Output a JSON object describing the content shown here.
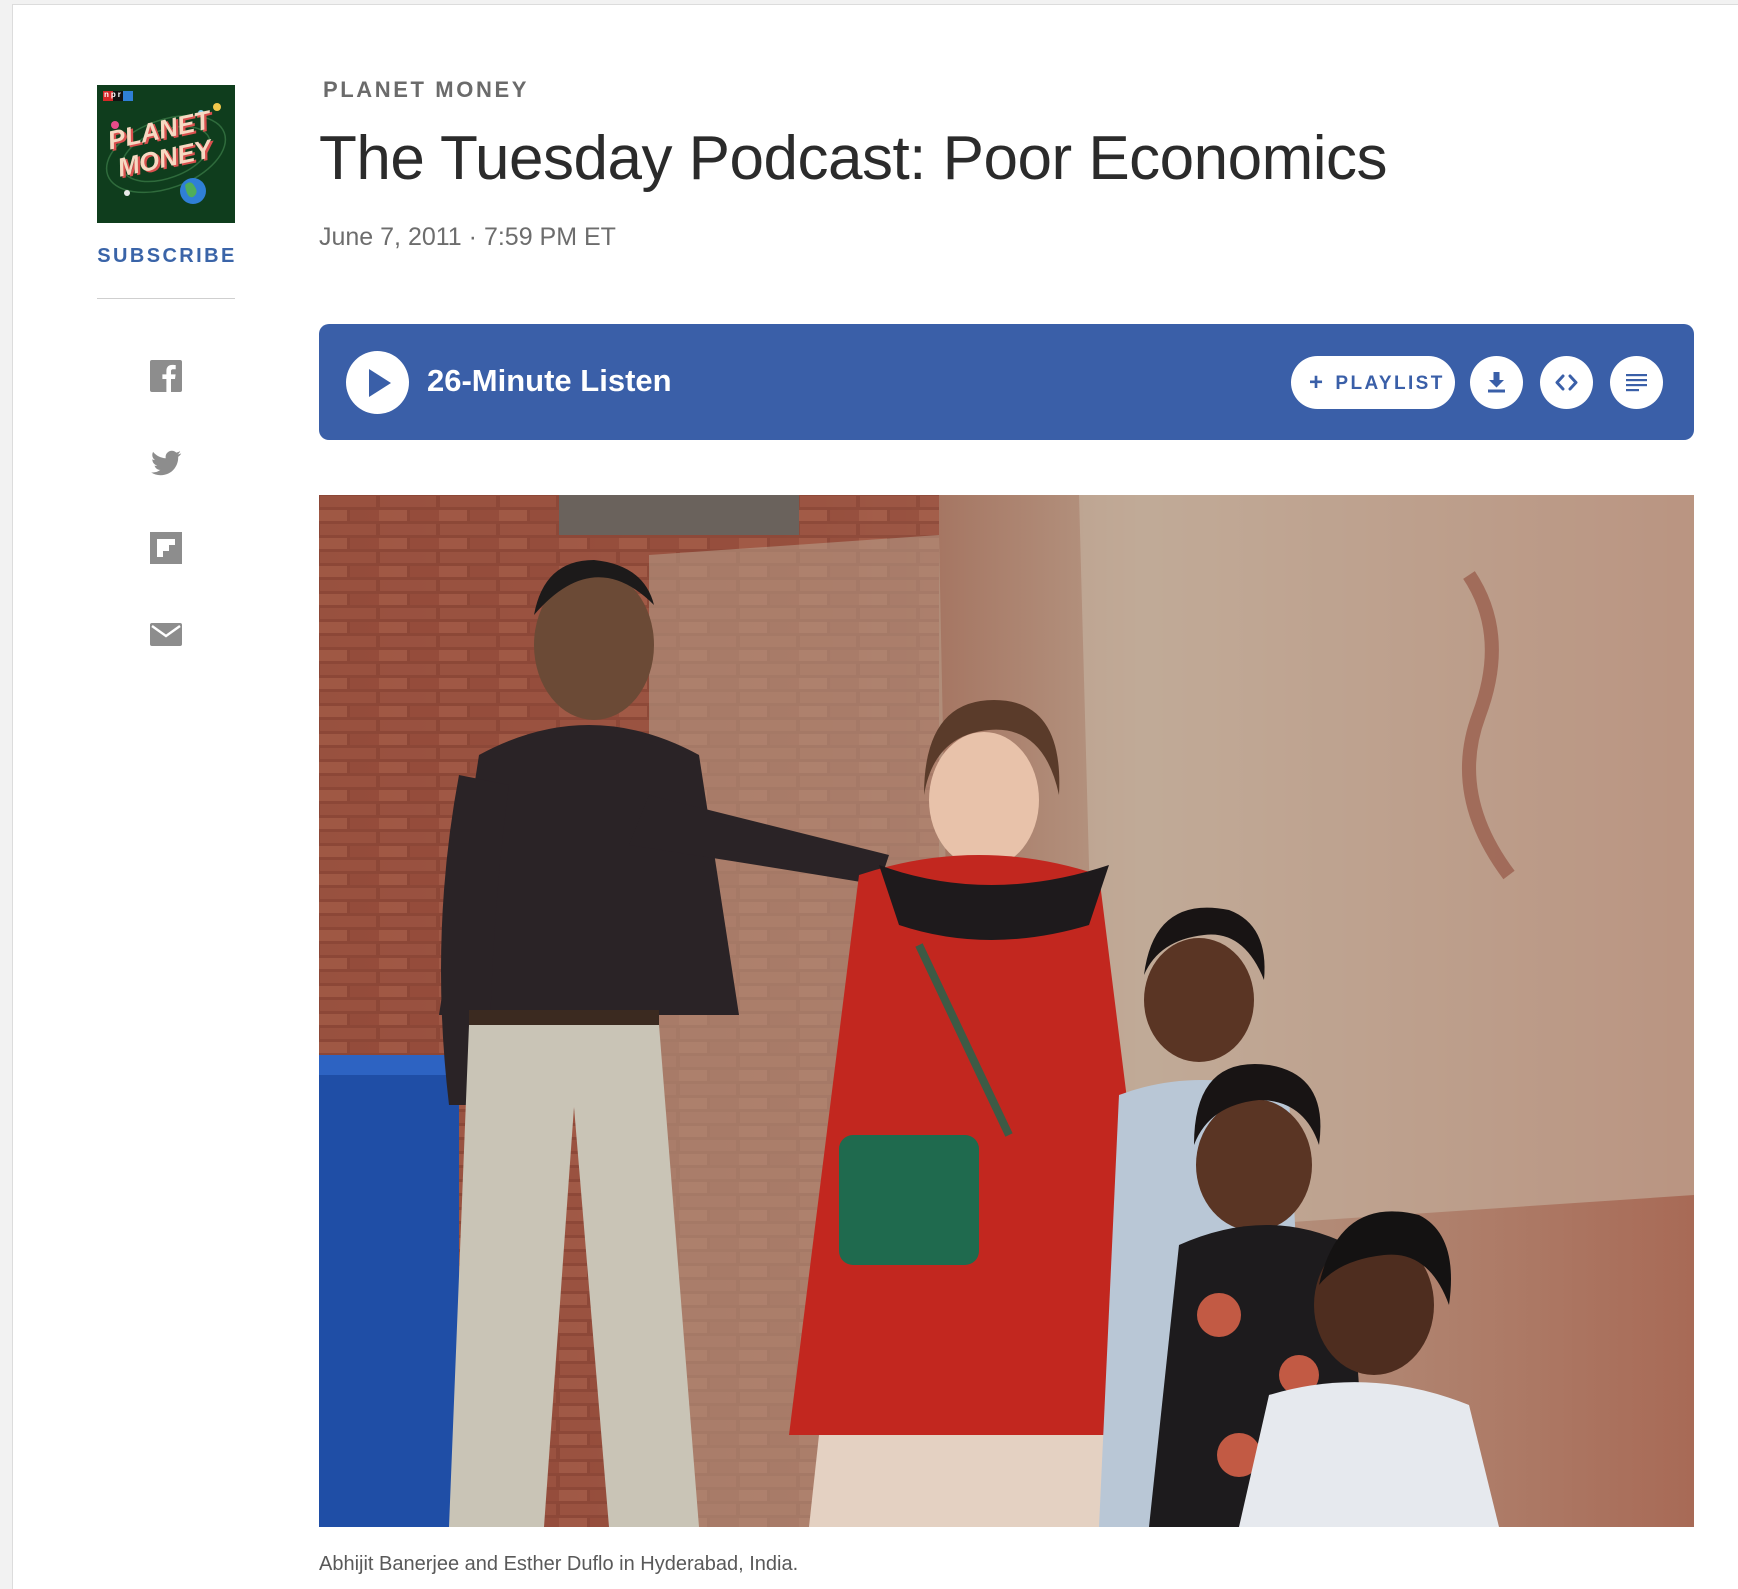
{
  "podcast": {
    "art_lines": [
      "PLANET",
      "MONEY"
    ],
    "art_badge": "npr",
    "subscribe_label": "SUBSCRIBE"
  },
  "share": {
    "items": [
      "facebook-icon",
      "twitter-icon",
      "flipboard-icon",
      "email-icon"
    ]
  },
  "article": {
    "kicker": "PLANET MONEY",
    "title": "The Tuesday Podcast: Poor Economics",
    "date": "June 7, 2011",
    "separator": "·",
    "time": "7:59 PM ET"
  },
  "player": {
    "listen_label": "26-Minute Listen",
    "playlist_label": "PLAYLIST",
    "buttons": [
      "download-icon",
      "embed-icon",
      "transcript-icon"
    ]
  },
  "image": {
    "caption": "Abhijit Banerjee and Esther Duflo in Hyderabad, India."
  },
  "colors": {
    "accent_blue": "#3a5fa8",
    "art_green": "#0f3d1d",
    "text_dark": "#2b2b2b",
    "text_muted": "#6d6d6d"
  }
}
